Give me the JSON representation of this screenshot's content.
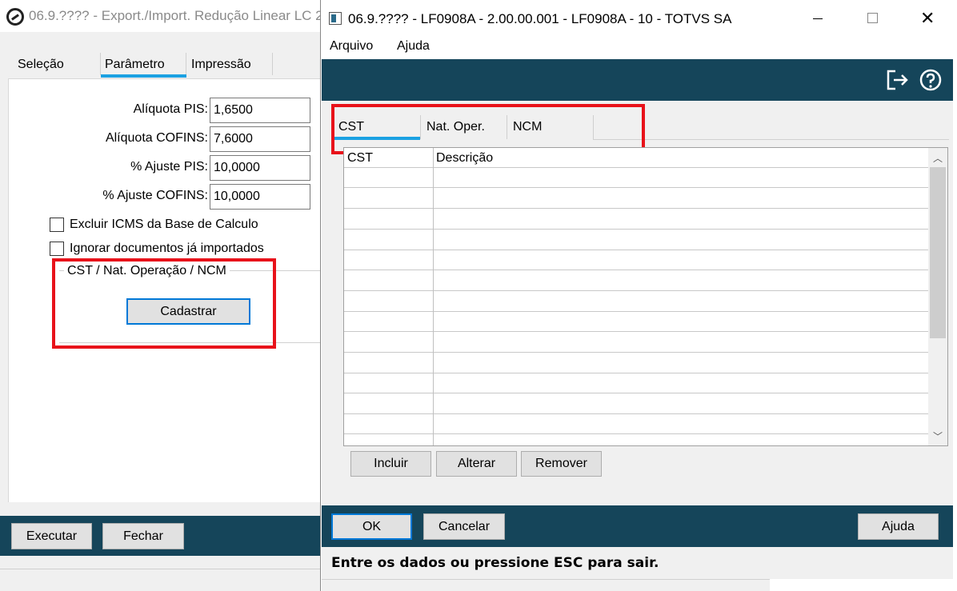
{
  "back_window": {
    "title": "06.9.???? - Export./Import. Redução Linear LC 2",
    "tabs": [
      {
        "label": "Seleção"
      },
      {
        "label": "Parâmetro"
      },
      {
        "label": "Impressão"
      }
    ],
    "fields": [
      {
        "label": "Alíquota PIS:",
        "value": "1,6500"
      },
      {
        "label": "Alíquota COFINS:",
        "value": "7,6000"
      },
      {
        "label": "% Ajuste PIS:",
        "value": "10,0000"
      },
      {
        "label": "% Ajuste COFINS:",
        "value": "10,0000"
      }
    ],
    "checkboxes": [
      {
        "label": "Excluir ICMS da Base de Calculo",
        "checked": false
      },
      {
        "label": "Ignorar documentos já importados",
        "checked": false
      }
    ],
    "group_label": "CST / Nat. Operação / NCM",
    "cadastrar_label": "Cadastrar",
    "executar_label": "Executar",
    "fechar_label": "Fechar"
  },
  "front_window": {
    "title": "06.9.???? - LF0908A - 2.00.00.001 - LF0908A - 10 - TOTVS SA",
    "menu": [
      {
        "label": "Arquivo"
      },
      {
        "label": "Ajuda"
      }
    ],
    "tabs": [
      {
        "label": "CST"
      },
      {
        "label": "Nat. Oper."
      },
      {
        "label": "NCM"
      }
    ],
    "grid": {
      "columns": [
        "CST",
        "Descrição"
      ],
      "rows": []
    },
    "grid_buttons": {
      "incluir": "Incluir",
      "alterar": "Alterar",
      "remover": "Remover"
    },
    "footer": {
      "ok": "OK",
      "cancelar": "Cancelar",
      "ajuda": "Ajuda"
    },
    "status": "Entre os dados ou pressione ESC para sair."
  },
  "colors": {
    "accent_bar": "#15455a",
    "tab_underline": "#1ba1e2",
    "highlight": "#e8121a",
    "focus_border": "#0078d7"
  }
}
